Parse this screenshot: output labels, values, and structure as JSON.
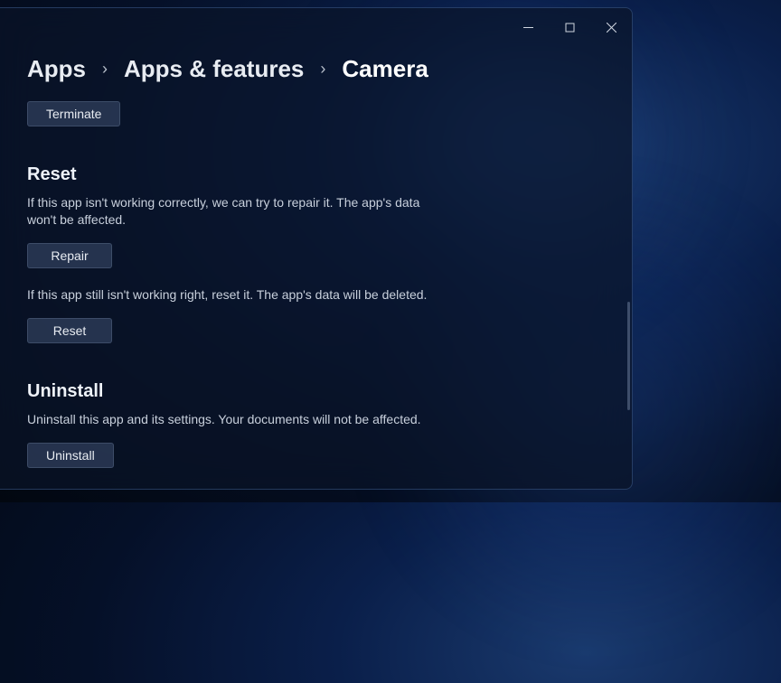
{
  "breadcrumb": {
    "level1": "Apps",
    "level2": "Apps & features",
    "current": "Camera"
  },
  "terminate": {
    "button_label": "Terminate"
  },
  "reset_section": {
    "title": "Reset",
    "repair_desc": "If this app isn't working correctly, we can try to repair it. The app's data won't be affected.",
    "repair_button": "Repair",
    "reset_desc": "If this app still isn't working right, reset it. The app's data will be deleted.",
    "reset_button": "Reset"
  },
  "uninstall_section": {
    "title": "Uninstall",
    "desc": "Uninstall this app and its settings. Your documents will not be affected.",
    "button_label": "Uninstall"
  }
}
